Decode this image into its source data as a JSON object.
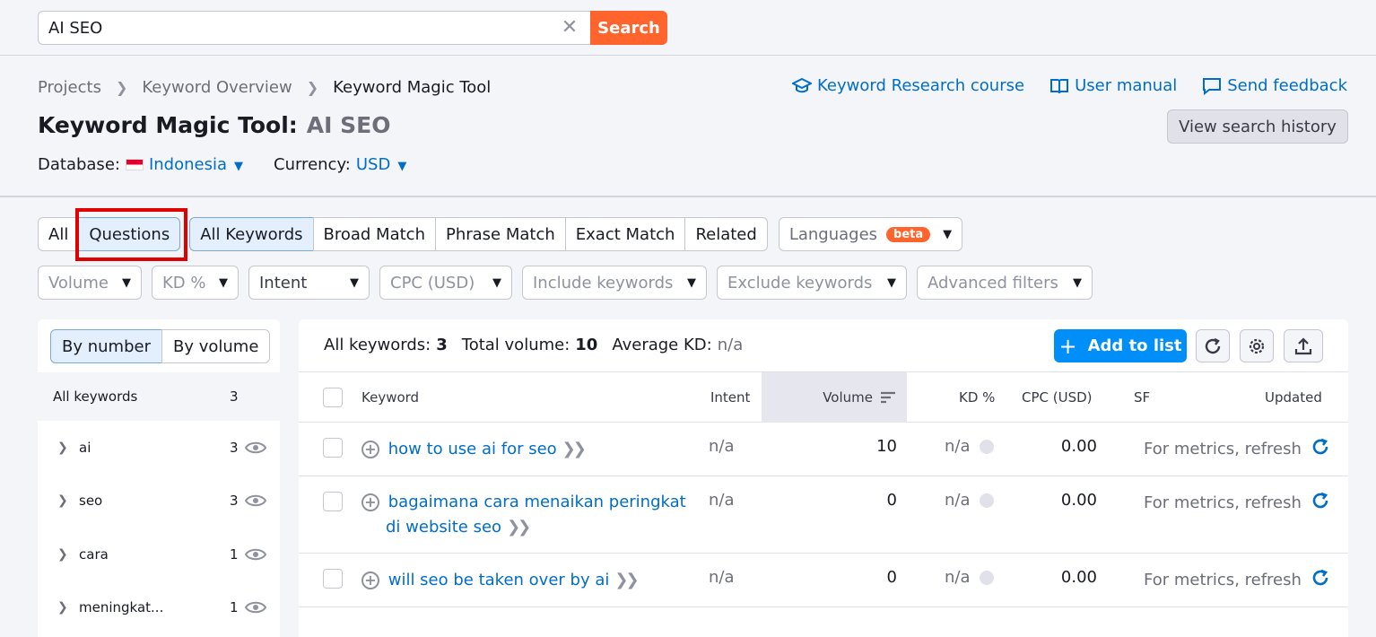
{
  "search": {
    "query": "AI SEO",
    "button": "Search"
  },
  "breadcrumb": [
    "Projects",
    "Keyword Overview",
    "Keyword Magic Tool"
  ],
  "title": {
    "tool": "Keyword Magic Tool:",
    "query": "AI SEO"
  },
  "database": {
    "label": "Database:",
    "value": "Indonesia"
  },
  "currency": {
    "label": "Currency:",
    "value": "USD"
  },
  "top_links": {
    "course": "Keyword Research course",
    "manual": "User manual",
    "feedback": "Send feedback"
  },
  "history_button": "View search history",
  "tabs": {
    "all": "All",
    "questions": "Questions",
    "all_keywords": "All Keywords",
    "broad": "Broad Match",
    "phrase": "Phrase Match",
    "exact": "Exact Match",
    "related": "Related"
  },
  "languages": {
    "label": "Languages",
    "badge": "beta"
  },
  "filters": [
    "Volume",
    "KD %",
    "Intent",
    "CPC (USD)",
    "Include keywords",
    "Exclude keywords",
    "Advanced filters"
  ],
  "sidebar": {
    "by_number": "By number",
    "by_volume": "By volume",
    "all_keywords_label": "All keywords",
    "all_keywords_count": "3",
    "groups": [
      {
        "name": "ai",
        "count": "3"
      },
      {
        "name": "seo",
        "count": "3"
      },
      {
        "name": "cara",
        "count": "1"
      },
      {
        "name": "meningkat...",
        "count": "1"
      }
    ]
  },
  "summary": {
    "all_label": "All keywords:",
    "all_value": "3",
    "volume_label": "Total volume:",
    "volume_value": "10",
    "kd_label": "Average KD:",
    "kd_value": "n/a"
  },
  "add_to_list": "Add to list",
  "columns": {
    "keyword": "Keyword",
    "intent": "Intent",
    "volume": "Volume",
    "kd": "KD %",
    "cpc": "CPC (USD)",
    "sf": "SF",
    "updated": "Updated"
  },
  "rows": [
    {
      "keyword_line1": "how to use ai for seo",
      "keyword_line2": "",
      "intent": "n/a",
      "volume": "10",
      "kd": "n/a",
      "cpc": "0.00",
      "updated": "For metrics, refresh"
    },
    {
      "keyword_line1": "bagaimana cara menaikan peringkat",
      "keyword_line2": "di website seo",
      "intent": "n/a",
      "volume": "0",
      "kd": "n/a",
      "cpc": "0.00",
      "updated": "For metrics, refresh"
    },
    {
      "keyword_line1": "will seo be taken over by ai",
      "keyword_line2": "",
      "intent": "n/a",
      "volume": "0",
      "kd": "n/a",
      "cpc": "0.00",
      "updated": "For metrics, refresh"
    }
  ]
}
